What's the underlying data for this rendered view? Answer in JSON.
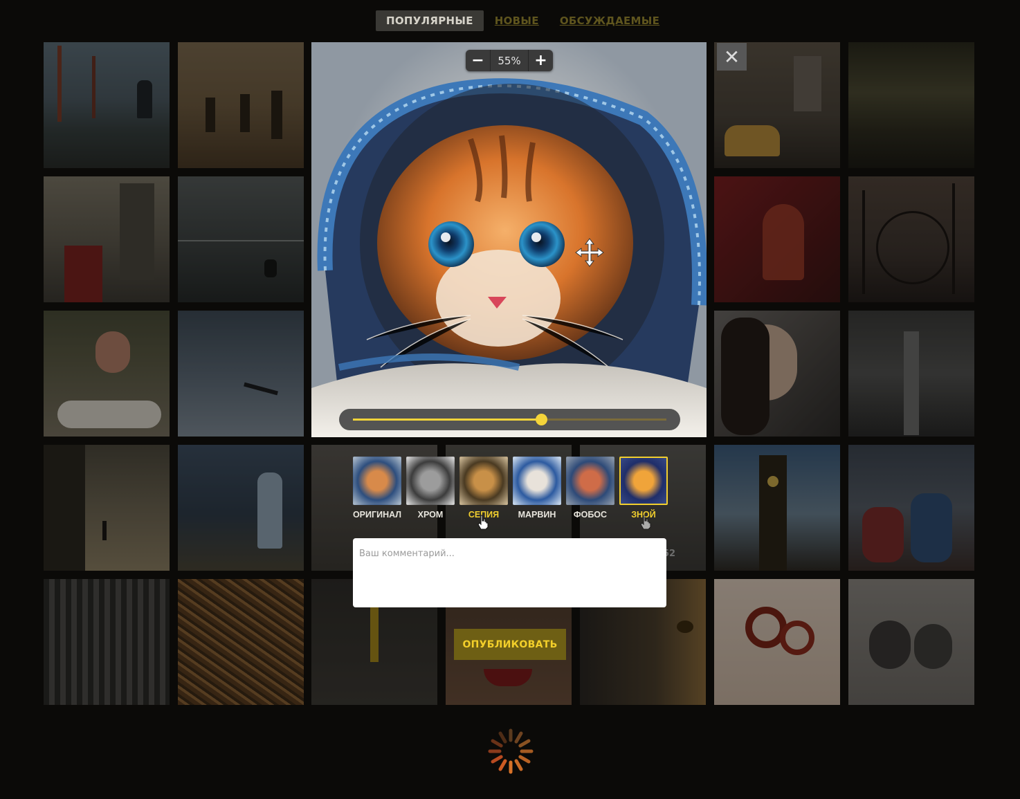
{
  "nav": {
    "tabs": [
      {
        "label": "ПОПУЛЯРНЫЕ",
        "active": true
      },
      {
        "label": "НОВЫЕ",
        "active": false
      },
      {
        "label": "ОБСУЖДАЕМЫЕ",
        "active": false
      }
    ]
  },
  "editor": {
    "zoom": {
      "minus": "−",
      "value": "55%",
      "plus": "+"
    },
    "close_label": "✕",
    "intensity": 0.6,
    "filters": [
      {
        "label": "ОРИГИНАЛ",
        "selected": false,
        "highlight": false
      },
      {
        "label": "ХРОМ",
        "selected": false,
        "highlight": false
      },
      {
        "label": "СЕПИЯ",
        "selected": false,
        "highlight": true
      },
      {
        "label": "МАРВИН",
        "selected": false,
        "highlight": false
      },
      {
        "label": "ФОБОС",
        "selected": false,
        "highlight": false
      },
      {
        "label": "ЗНОЙ",
        "selected": true,
        "highlight": true
      }
    ],
    "comment_placeholder": "Ваш комментарий...",
    "publish_label": "ОПУБЛИКОВАТЬ"
  },
  "grid": {
    "partial_count": "52"
  },
  "colors": {
    "accent": "#f2cf2e",
    "background": "#0b0a08"
  }
}
